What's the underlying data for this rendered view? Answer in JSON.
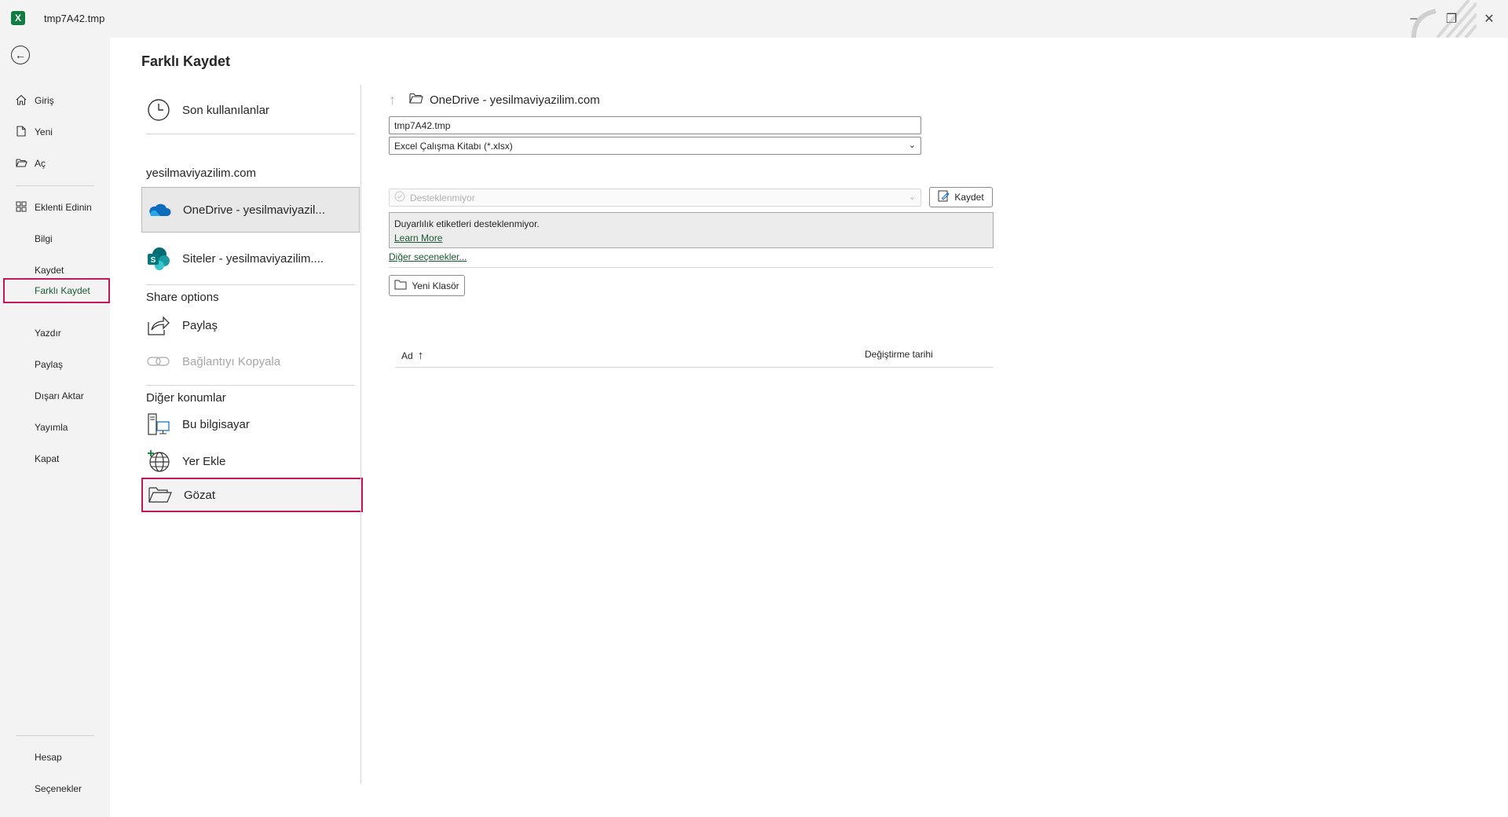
{
  "window": {
    "title": "tmp7A42.tmp",
    "app_icon": "excel-icon",
    "controls": [
      "minimize-icon",
      "restore-icon",
      "close-icon"
    ]
  },
  "nav": {
    "back_icon": "back-arrow-icon",
    "items": [
      {
        "label": "Giriş",
        "icon": "home-icon"
      },
      {
        "label": "Yeni",
        "icon": "new-file-icon"
      },
      {
        "label": "Aç",
        "icon": "open-folder-icon"
      },
      {
        "label": "Eklenti Edinin",
        "icon": "addins-icon"
      },
      {
        "label": "Bilgi"
      },
      {
        "label": "Kaydet"
      },
      {
        "label": "Farklı Kaydet",
        "selected": true
      },
      {
        "label": "Yazdır"
      },
      {
        "label": "Paylaş"
      },
      {
        "label": "Dışarı Aktar"
      },
      {
        "label": "Yayımla"
      },
      {
        "label": "Kapat"
      }
    ],
    "bottom_items": [
      {
        "label": "Hesap"
      },
      {
        "label": "Seçenekler"
      }
    ]
  },
  "page": {
    "title": "Farklı Kaydet"
  },
  "locations": {
    "recent": "Son kullanılanlar",
    "account_header": "yesilmaviyazilim.com",
    "onedrive": "OneDrive - yesilmaviyazil...",
    "sites": "Siteler - yesilmaviyazilim....",
    "share_header": "Share options",
    "share": "Paylaş",
    "copy_link": "Bağlantıyı Kopyala",
    "other_header": "Diğer konumlar",
    "this_pc": "Bu bilgisayar",
    "add_place": "Yer Ekle",
    "browse": "Gözat"
  },
  "save_pane": {
    "path": "OneDrive - yesilmaviyazilim.com",
    "filename": "tmp7A42.tmp",
    "filetype": "Excel Çalışma Kitabı (*.xlsx)",
    "sensitivity": "Desteklenmiyor",
    "save_label": "Kaydet",
    "sensitivity_msg": "Duyarlılık etiketleri desteklenmiyor.",
    "learn_more": "Learn More",
    "more_options": "Diğer seçenekler...",
    "new_folder": "Yeni Klasör",
    "col_name": "Ad",
    "col_date": "Değiştirme tarihi"
  }
}
